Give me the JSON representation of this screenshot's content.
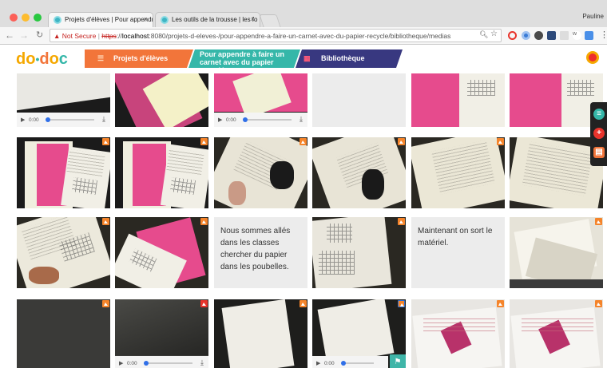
{
  "browser": {
    "tabs": [
      {
        "title": "Projets d'élèves | Pour appendr",
        "active": true
      },
      {
        "title": "Les outils de la trousse | les fo",
        "active": false
      }
    ],
    "profile_name": "Pauline",
    "url": {
      "security_label": "Not Secure",
      "scheme": "https",
      "host": "localhost",
      "path": ":8080/projets-d-eleves-/pour-appendre-a-faire-un-carnet-avec-du-papier-recycle/bibliotheque/medias"
    }
  },
  "site": {
    "logo_text": "do•doc",
    "breadcrumbs": [
      {
        "label": "Projets d'élèves",
        "color": "#f2753a",
        "icon": "grid-icon"
      },
      {
        "label": "Pour appendre à faire un carnet avec du papier recyclé",
        "color": "#35b7a9"
      },
      {
        "label": "Bibliothèque",
        "color": "#383880",
        "icon": "grid-icon"
      }
    ]
  },
  "players": {
    "time_label": "0:00"
  },
  "notes": [
    "Nous sommes allés dans les classes chercher du papier dans les poubelles.",
    "Maintenant on sort le matériel."
  ],
  "colors": {
    "orange": "#f5842a",
    "teal": "#35b7a9",
    "navy": "#383880",
    "red": "#e8342c"
  }
}
